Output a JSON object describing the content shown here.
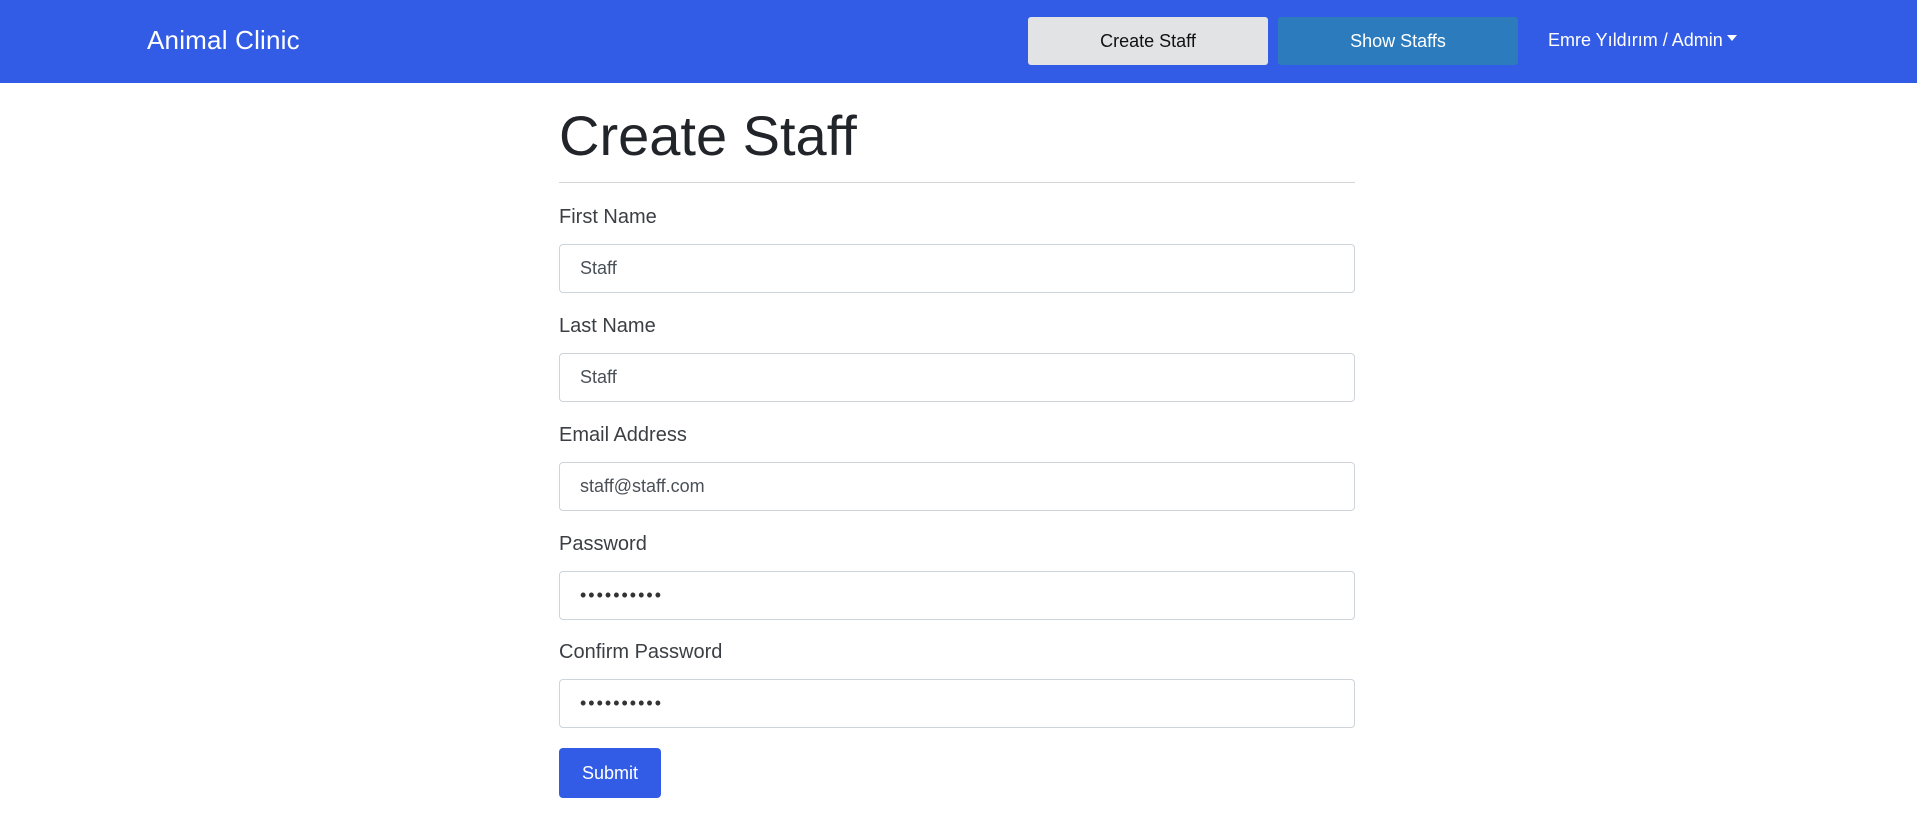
{
  "navbar": {
    "brand": "Animal Clinic",
    "create_staff_label": "Create Staff",
    "show_staffs_label": "Show Staffs",
    "user_label": "Emre Yıldırım / Admin",
    "colors": {
      "background": "#335ce6",
      "create_button": "#e2e3e5",
      "show_button": "#2b7bbd"
    }
  },
  "form": {
    "title": "Create Staff",
    "fields": [
      {
        "label": "First Name",
        "value": "Staff",
        "type": "text"
      },
      {
        "label": "Last Name",
        "value": "Staff",
        "type": "text"
      },
      {
        "label": "Email Address",
        "value": "staff@staff.com",
        "type": "email"
      },
      {
        "label": "Password",
        "value": "••••••••••",
        "type": "password"
      },
      {
        "label": "Confirm Password",
        "value": "••••••••••",
        "type": "password"
      }
    ],
    "submit_label": "Submit",
    "icons": {
      "user_menu": "caret-down-icon"
    }
  }
}
